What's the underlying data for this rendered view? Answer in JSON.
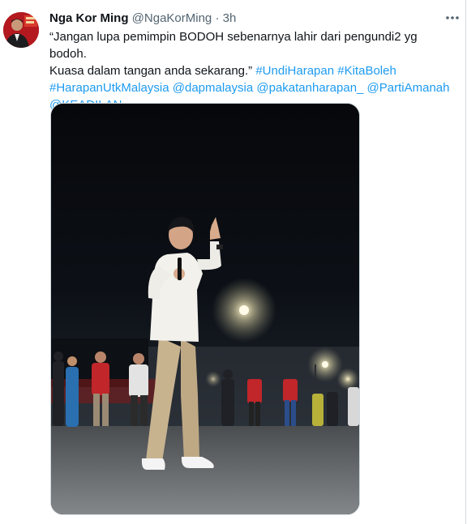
{
  "tweet": {
    "author_name": "Nga Kor Ming",
    "author_handle": "@NgaKorMing",
    "separator": "·",
    "time": "3h",
    "text_line1": "“Jangan lupa pemimpin BODOH sebenarnya lahir dari pengundi2 yg bodoh.",
    "text_line2_plain": "Kuasa dalam tangan anda sekarang.” ",
    "hashtags_line2": [
      "#UndiHarapan",
      "#KitaBoleh"
    ],
    "links_line3": [
      "#HarapanUtkMalaysia",
      "@dapmalaysia",
      "@pakatanharapan_",
      "@PartiAmanah"
    ],
    "links_line4": [
      "@KEADILAN"
    ]
  },
  "icons": {
    "more": "more-horizontal-icon"
  },
  "colors": {
    "link": "#1d9bf0",
    "secondary_text": "#536471",
    "border": "#cfd9de"
  }
}
